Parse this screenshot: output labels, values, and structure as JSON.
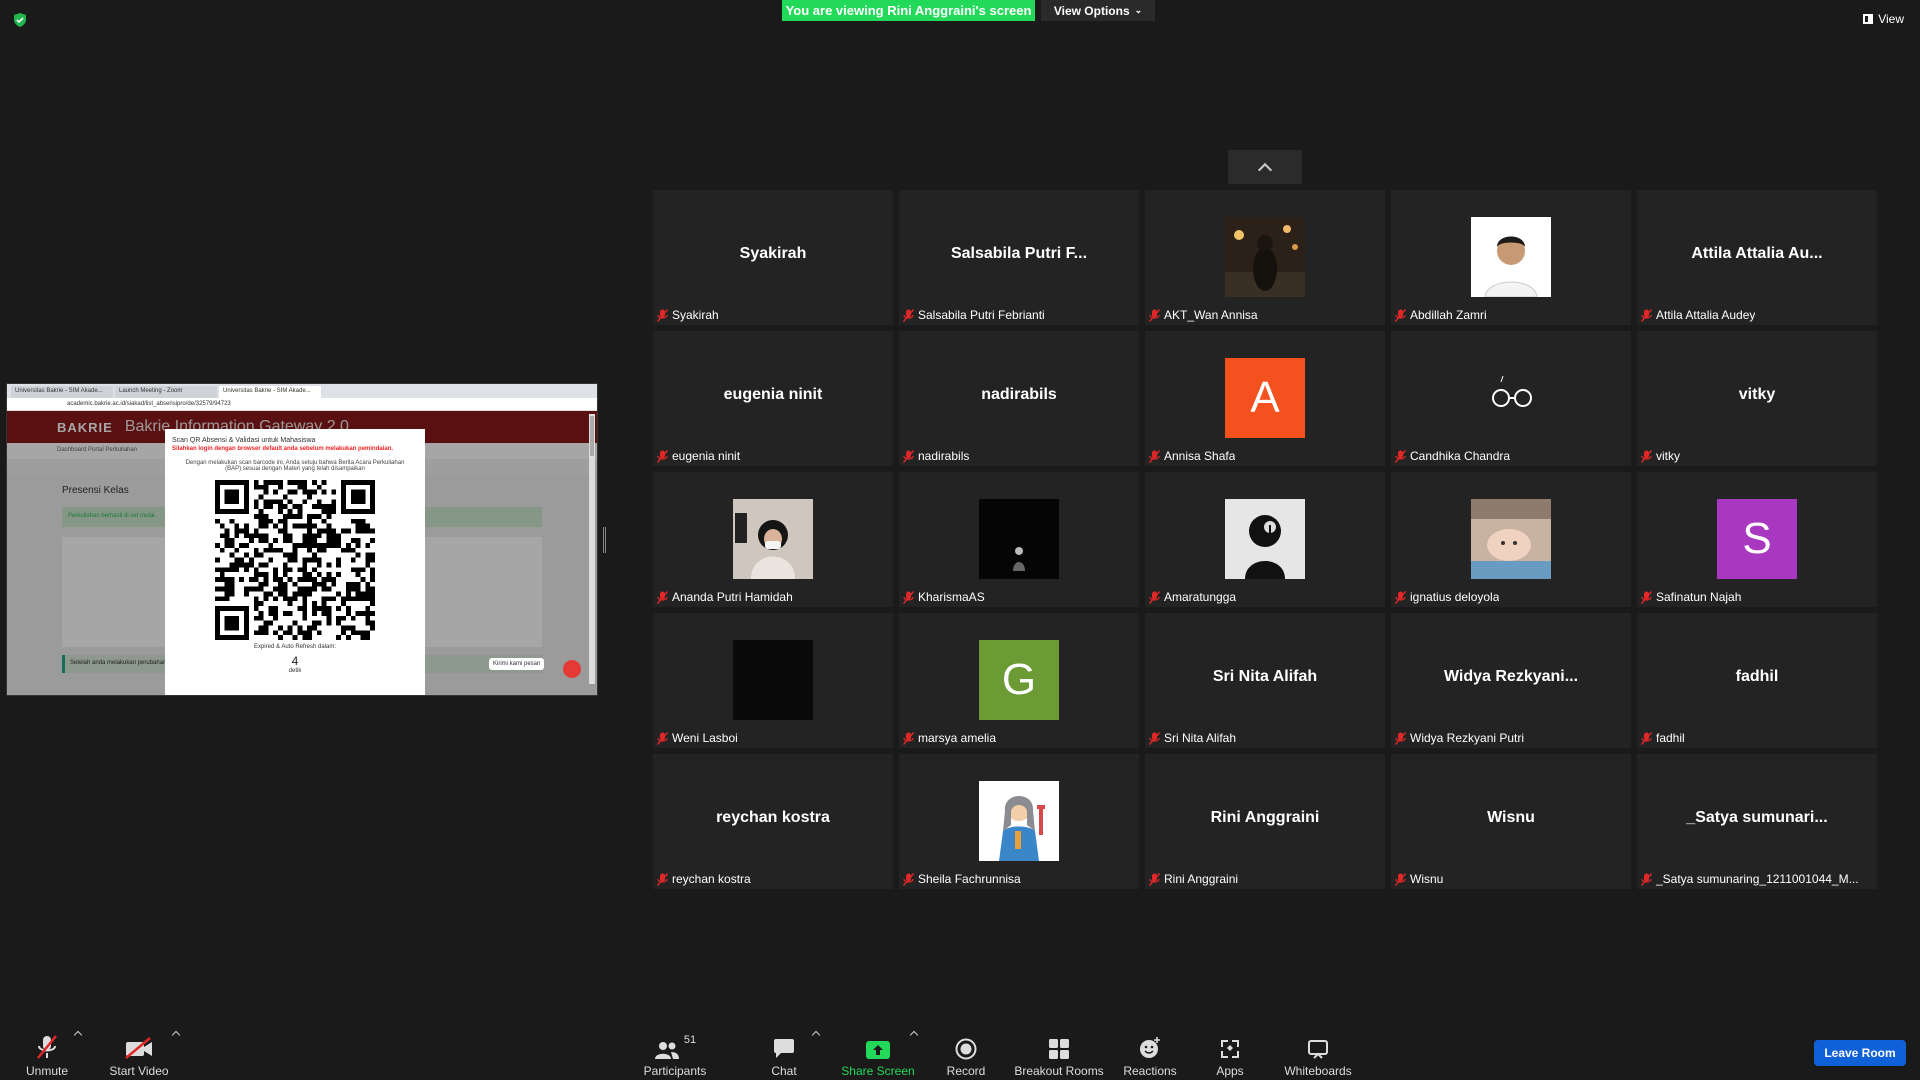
{
  "banner": {
    "viewing": "You are viewing Rini Anggraini's screen",
    "view_options": "View Options"
  },
  "view_button": "View",
  "share": {
    "tabs": [
      "Universitas Bakrie - SIM Akade...",
      "Launch Meeting - Zoom",
      "Universitas Bakrie - SIM Akade..."
    ],
    "url": "academic.bakrie.ac.id/siakad/list_absensipro/de/32579/94723",
    "logo": "BAKRIE",
    "site_title": "Bakrie Information Gateway 2.0",
    "nav": "Dashboard   Portal   Perkuliahan",
    "heading": "Presensi Kelas",
    "alert": "Perkuliahan berhasil di set mulai.",
    "alert2": "Setelah anda melakukan perubahan",
    "modal": {
      "title": "Scan QR Absensi & Validasi untuk Mahasiswa",
      "warning": "Silahkan login dengan browser default anda sebelum melakukan pemindaian.",
      "text": "Dengan melakukan scan barcode ini, Anda setuju bahwa Berita Acara Perkuliahan (BAP) sesuai dengan Materi yang telah disampaikan",
      "expire": "Expired & Auto Refresh dalam:",
      "count": "4",
      "unit": "detik"
    },
    "chat_bubble": "Kirimi kami pesan"
  },
  "participants": [
    {
      "display": "Syakirah",
      "label": "Syakirah",
      "type": "name"
    },
    {
      "display": "Salsabila Putri F...",
      "label": "Salsabila Putri Febrianti",
      "type": "name"
    },
    {
      "display": "",
      "label": "AKT_Wan Annisa",
      "type": "photo",
      "photo": "photo-night-city"
    },
    {
      "display": "",
      "label": "Abdillah Zamri",
      "type": "photo",
      "photo": "photo-portrait"
    },
    {
      "display": "Attila Attalia Au...",
      "label": "Attila Attalia Audey",
      "type": "name"
    },
    {
      "display": "eugenia ninit",
      "label": "eugenia ninit",
      "type": "name"
    },
    {
      "display": "nadirabils",
      "label": "nadirabils",
      "type": "name"
    },
    {
      "display": "A",
      "label": "Annisa Shafa",
      "type": "letter",
      "color": "#f4511e"
    },
    {
      "display": "",
      "label": "Candhika Chandra",
      "type": "photo",
      "photo": "glasses-icon"
    },
    {
      "display": "vitky",
      "label": "vitky",
      "type": "name"
    },
    {
      "display": "",
      "label": "Ananda Putri Hamidah",
      "type": "photo",
      "photo": "photo-selfie"
    },
    {
      "display": "",
      "label": "KharismaAS",
      "type": "photo",
      "photo": "photo-dark-figure"
    },
    {
      "display": "",
      "label": "Amaratungga",
      "type": "photo",
      "photo": "photo-silhouette"
    },
    {
      "display": "",
      "label": "ignatius deloyola",
      "type": "photo",
      "photo": "photo-baby"
    },
    {
      "display": "S",
      "label": "Safinatun Najah",
      "type": "letter",
      "color": "#a838c0"
    },
    {
      "display": "",
      "label": "Weni Lasboi",
      "type": "photo",
      "photo": "photo-black"
    },
    {
      "display": "G",
      "label": "marsya amelia",
      "type": "letter",
      "color": "#6c9b36"
    },
    {
      "display": "Sri Nita Alifah",
      "label": "Sri Nita Alifah",
      "type": "name"
    },
    {
      "display": "Widya Rezkyani...",
      "label": "Widya Rezkyani Putri",
      "type": "name"
    },
    {
      "display": "fadhil",
      "label": "fadhil",
      "type": "name"
    },
    {
      "display": "reychan kostra",
      "label": "reychan kostra",
      "type": "name"
    },
    {
      "display": "",
      "label": "Sheila Fachrunnisa",
      "type": "photo",
      "photo": "photo-cartoon"
    },
    {
      "display": "Rini Anggraini",
      "label": "Rini Anggraini",
      "type": "name"
    },
    {
      "display": "Wisnu",
      "label": "Wisnu",
      "type": "name"
    },
    {
      "display": "_Satya sumunari...",
      "label": "_Satya sumunaring_1211001044_M...",
      "type": "name"
    }
  ],
  "toolbar": {
    "unmute": "Unmute",
    "start_video": "Start Video",
    "participants": "Participants",
    "participants_count": "51",
    "chat": "Chat",
    "share_screen": "Share Screen",
    "record": "Record",
    "breakout": "Breakout Rooms",
    "reactions": "Reactions",
    "apps": "Apps",
    "whiteboards": "Whiteboards",
    "leave": "Leave Room"
  },
  "colors": {
    "accent_green": "#23d959",
    "leave_blue": "#1060d8",
    "mute_red": "#e02828"
  }
}
